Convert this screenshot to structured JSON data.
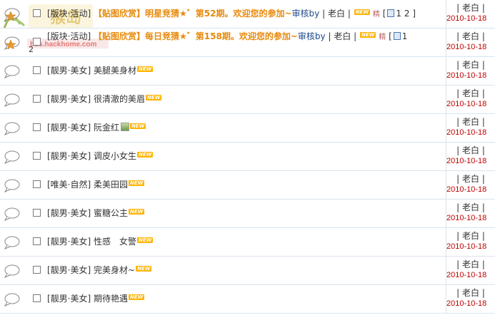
{
  "rows": [
    {
      "forum": "[版块·活动]",
      "title": "【贴图欣赏】明星竞猜★゛第52期。欢迎您的参加~",
      "mod": "审核by",
      "mod_user": "老白",
      "pages": "1 2",
      "author": "老白",
      "date": "2010-10-18"
    },
    {
      "forum": "[版块·活动]",
      "title": "【贴图欣赏】每日竞猜★゛第158期。欢迎您的参加~",
      "mod": "审核by",
      "mod_user": "老白",
      "pages_line1": "1",
      "pages_line2": "2",
      "author": "老白",
      "date": "2010-10-18"
    },
    {
      "forum": "[靓男·美女]",
      "title": "美腿美身材",
      "author": "老白",
      "date": "2010-10-18"
    },
    {
      "forum": "[靓男·美女]",
      "title": "很清澈的美眉",
      "author": "老白",
      "date": "2010-10-18"
    },
    {
      "forum": "[靓男·美女]",
      "title": "阮金红",
      "author": "老白",
      "date": "2010-10-18"
    },
    {
      "forum": "[靓男·美女]",
      "title": "调皮小女生",
      "author": "老白",
      "date": "2010-10-18"
    },
    {
      "forum": "[唯美·自然]",
      "title": "柔美田园",
      "author": "老白",
      "date": "2010-10-18"
    },
    {
      "forum": "[靓男·美女]",
      "title": "蜜糖公主",
      "author": "老白",
      "date": "2010-10-18"
    },
    {
      "forum": "[靓男·美女]",
      "title": "性感　女警",
      "author": "老白",
      "date": "2010-10-18"
    },
    {
      "forum": "[靓男·美女]",
      "title": "完美身材~",
      "author": "老白",
      "date": "2010-10-18"
    },
    {
      "forum": "[靓男·美女]",
      "title": "期待艳遇",
      "author": "老白",
      "date": "2010-10-18"
    }
  ],
  "labels": {
    "new": "NEW",
    "bar": "|"
  },
  "watermark": {
    "text": "猴岛",
    "url": "bbs.hackhome.com"
  },
  "colors": {
    "hot_title": "#e88a0b",
    "date": "#c00000",
    "border": "#d9e4ee"
  }
}
